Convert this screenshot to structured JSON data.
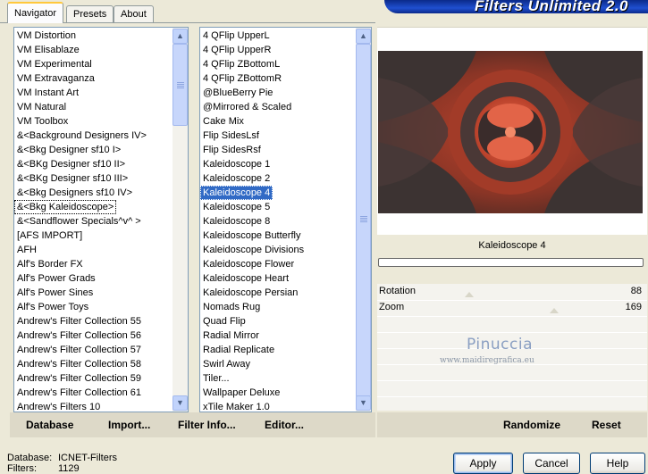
{
  "tabs": [
    {
      "label": "Navigator",
      "active": true
    },
    {
      "label": "Presets",
      "active": false
    },
    {
      "label": "About",
      "active": false
    }
  ],
  "banner_title": "Filters Unlimited 2.0",
  "categories": {
    "items": [
      "VM Distortion",
      "VM Elisablaze",
      "VM Experimental",
      "VM Extravaganza",
      "VM Instant Art",
      "VM Natural",
      "VM Toolbox",
      "&<Background Designers IV>",
      "&<Bkg Designer sf10 I>",
      "&<BKg Designer sf10 II>",
      "&<BKg Designer sf10 III>",
      "&<Bkg Designers sf10 IV>",
      "&<Bkg Kaleidoscope>",
      "&<Sandflower Specials^v^ >",
      "[AFS IMPORT]",
      "AFH",
      "Alf's Border FX",
      "Alf's Power Grads",
      "Alf's Power Sines",
      "Alf's Power Toys",
      "Andrew's Filter Collection 55",
      "Andrew's Filter Collection 56",
      "Andrew's Filter Collection 57",
      "Andrew's Filter Collection 58",
      "Andrew's Filter Collection 59",
      "Andrew's Filter Collection 61",
      "Andrew's Filters 10"
    ],
    "selected": "&<Bkg Kaleidoscope>"
  },
  "filters": {
    "items": [
      "4 QFlip UpperL",
      "4 QFlip UpperR",
      "4 QFlip ZBottomL",
      "4 QFlip ZBottomR",
      "@BlueBerry Pie",
      "@Mirrored & Scaled",
      "Cake Mix",
      "Flip SidesLsf",
      "Flip SidesRsf",
      "Kaleidoscope 1",
      "Kaleidoscope 2",
      "Kaleidoscope 4",
      "Kaleidoscope 5",
      "Kaleidoscope 8",
      "Kaleidoscope Butterfly",
      "Kaleidoscope Divisions",
      "Kaleidoscope Flower",
      "Kaleidoscope Heart",
      "Kaleidoscope Persian",
      "Nomads Rug",
      "Quad Flip",
      "Radial Mirror",
      "Radial Replicate",
      "Swirl Away",
      "Tiler...",
      "Wallpaper Deluxe",
      "xTile Maker 1.0"
    ],
    "selected": "Kaleidoscope 4"
  },
  "commands": {
    "database": "Database",
    "import": "Import...",
    "filter_info": "Filter Info...",
    "editor": "Editor..."
  },
  "preview": {
    "filter_name": "Kaleidoscope 4",
    "progress": 0
  },
  "params": [
    {
      "label": "Rotation",
      "value": "88",
      "level": 0.345
    },
    {
      "label": "Zoom",
      "value": "169",
      "level": 0.663
    }
  ],
  "watermark": {
    "name": "Pinuccia",
    "url": "www.maidiregrafica.eu"
  },
  "right_commands": {
    "randomize": "Randomize",
    "reset": "Reset"
  },
  "status": {
    "database_label": "Database:",
    "database_value": "ICNET-Filters",
    "filters_label": "Filters:",
    "filters_value": "1129"
  },
  "buttons": {
    "apply": "Apply",
    "cancel": "Cancel",
    "help": "Help"
  },
  "colors": {
    "selection": "#316ac5",
    "banner": "#1f4fd0"
  }
}
